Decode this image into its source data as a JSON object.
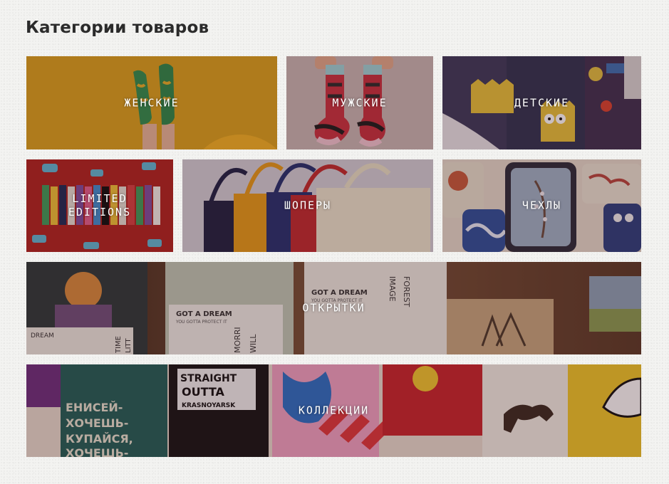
{
  "page": {
    "title": "Категории товаров"
  },
  "categories": [
    {
      "label": "ЖЕНСКИЕ"
    },
    {
      "label": "МУЖСКИЕ"
    },
    {
      "label": "ДЕТСКИЕ"
    },
    {
      "label": "LIMITED\nEDITIONS"
    },
    {
      "label": "ШОПЕРЫ"
    },
    {
      "label": "ЧЕХЛЫ"
    },
    {
      "label": "ОТКРЫТКИ"
    },
    {
      "label": "КОЛЛЕКЦИИ"
    }
  ],
  "artwork_text": {
    "cards_box1_top": "GOT A DREAM",
    "cards_box1_sub": "YOU GOTTA PROTECT IT",
    "cards_box2_top": "GOT A DREAM",
    "cards_box2_sub": "YOU GOTTA PROTECT IT",
    "cards_side_image": "IMAGE",
    "cards_side_forest": "FOREST",
    "cards_side_will": "WILL",
    "cards_side_morr": "MORRI",
    "cards_side_lit": "LITT",
    "cards_side_time": "TIME",
    "cards_dream": "DREAM",
    "coll_straight": "STRAIGHT",
    "coll_outta": "OUTTA",
    "coll_city": "KRASNOYARSK",
    "coll_sock_line1": "ЕНИСЕЙ-",
    "coll_sock_line2": "ХОЧЕШЬ-",
    "coll_sock_line3": "КУПАЙСЯ,",
    "coll_sock_line4": "ХОЧЕШЬ-"
  },
  "colors": {
    "page_background": "#f3f3f1",
    "title_text": "#2b2b2b",
    "label_text": "#ffffff",
    "tile_overlay": "rgba(60,20,30,0.28)"
  }
}
